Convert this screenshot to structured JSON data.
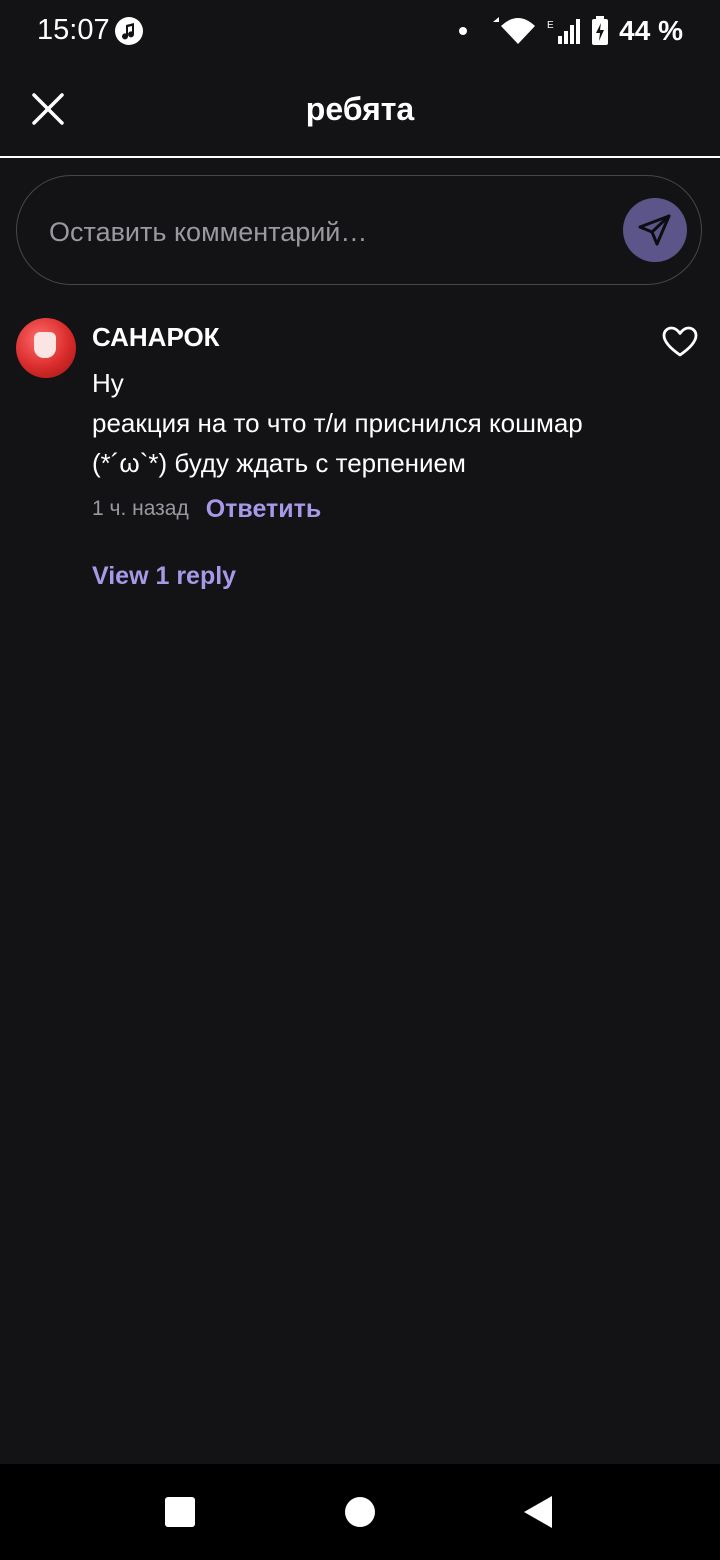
{
  "status_bar": {
    "time": "15:07",
    "battery": "44 %",
    "icons": [
      "music-icon",
      "notification-dot-icon",
      "wifi-icon",
      "signal-icon",
      "battery-charging-icon"
    ]
  },
  "header": {
    "title": "ребята",
    "close_icon": "close-icon"
  },
  "comment_input": {
    "placeholder": "Оставить комментарий…",
    "send_icon": "send-icon",
    "send_color": "#5b558a"
  },
  "comments": [
    {
      "username": "САНАРОК",
      "lines": [
        "Ну",
        "реакция на то что т/и приснился кошмар",
        "(*´ω`*) буду ждать с терпением"
      ],
      "time": "1 ч. назад",
      "reply_label": "Ответить",
      "view_replies": "View 1 reply"
    }
  ],
  "colors": {
    "background": "#131215",
    "accent": "#a898e8",
    "muted": "#9a99a1"
  },
  "nav_bar": {
    "icons": [
      "recent-apps-icon",
      "home-icon",
      "back-icon"
    ]
  }
}
